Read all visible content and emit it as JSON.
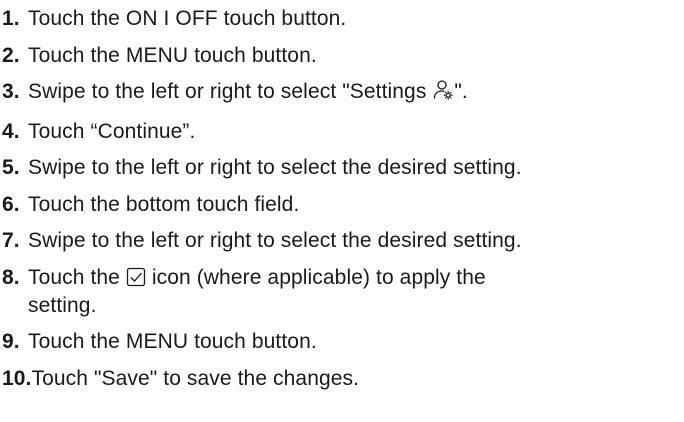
{
  "steps": [
    {
      "num": "1.",
      "text": "Touch the ON I OFF touch button."
    },
    {
      "num": "2.",
      "text": "Touch the MENU touch button."
    },
    {
      "num": "3.",
      "before": "Swipe to the left or right to select \"Settings ",
      "icon": "settings-icon",
      "after": "\"."
    },
    {
      "num": "4.",
      "text": "Touch “Continue”."
    },
    {
      "num": "5.",
      "text": "Swipe to the left or right to select the desired setting."
    },
    {
      "num": "6.",
      "text": "Touch the bottom touch field."
    },
    {
      "num": "7.",
      "text": "Swipe to the left or right to select the desired setting."
    },
    {
      "num": "8.",
      "before": "Touch the ",
      "icon": "checkbox-icon",
      "after": " icon (where applicable) to apply the setting."
    },
    {
      "num": "9.",
      "text": "Touch the MENU touch button."
    },
    {
      "num": "10.",
      "text": "Touch \"Save\" to save the changes."
    }
  ]
}
